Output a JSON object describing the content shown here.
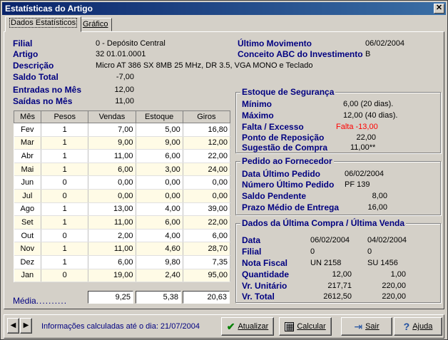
{
  "window": {
    "title": "Estatísticas do Artigo",
    "close_glyph": "✕"
  },
  "tabs": [
    {
      "label": "Dados Estatísticos"
    },
    {
      "label": "Gráfico"
    }
  ],
  "info": {
    "filial_label": "Filial",
    "filial_value": "0 - Depósito Central",
    "artigo_label": "Artigo",
    "artigo_value": "32  01.01.0001",
    "descricao_label": "Descrição",
    "descricao_value": "Micro AT 386 SX 8MB 25 MHz, DR 3.5, VGA MONO e Teclado",
    "saldo_label": "Saldo Total",
    "saldo_value": "-7,00",
    "entradas_label": "Entradas no Mês",
    "entradas_value": "12,00",
    "saidas_label": "Saídas no Mês",
    "saidas_value": "11,00",
    "ultimo_mov_label": "Último Movimento",
    "ultimo_mov_value": "06/02/2004",
    "abc_label": "Conceito ABC do Investimento",
    "abc_value": "B"
  },
  "grid": {
    "headers": [
      "Mês",
      "Pesos",
      "Vendas",
      "Estoque",
      "Giros"
    ],
    "rows": [
      [
        "Fev",
        "1",
        "7,00",
        "5,00",
        "16,80"
      ],
      [
        "Mar",
        "1",
        "9,00",
        "9,00",
        "12,00"
      ],
      [
        "Abr",
        "1",
        "11,00",
        "6,00",
        "22,00"
      ],
      [
        "Mai",
        "1",
        "6,00",
        "3,00",
        "24,00"
      ],
      [
        "Jun",
        "0",
        "0,00",
        "0,00",
        "0,00"
      ],
      [
        "Jul",
        "0",
        "0,00",
        "0,00",
        "0,00"
      ],
      [
        "Ago",
        "1",
        "13,00",
        "4,00",
        "39,00"
      ],
      [
        "Set",
        "1",
        "11,00",
        "6,00",
        "22,00"
      ],
      [
        "Out",
        "0",
        "2,00",
        "4,00",
        "6,00"
      ],
      [
        "Nov",
        "1",
        "11,00",
        "4,60",
        "28,70"
      ],
      [
        "Dez",
        "1",
        "6,00",
        "9,80",
        "7,35"
      ],
      [
        "Jan",
        "0",
        "19,00",
        "2,40",
        "95,00"
      ]
    ],
    "media_label": "Média",
    "media_vendas": "9,25",
    "media_estoque": "5,38",
    "media_giros": "20,63"
  },
  "estoque": {
    "title": "Estoque de Segurança",
    "minimo_label": "Mínimo",
    "minimo_value": "6,00  (20 dias).",
    "maximo_label": "Máximo",
    "maximo_value": "12,00  (40 dias).",
    "falta_label": "Falta / Excesso",
    "falta_value": "Falta -13,00",
    "reposicao_label": "Ponto de Reposição",
    "reposicao_value": "22,00",
    "sugestao_label": "Sugestão de Compra",
    "sugestao_value": "11,00**",
    "falta_color": "#ff0000"
  },
  "pedido": {
    "title": "Pedido ao Fornecedor",
    "data_label": "Data Último Pedido",
    "data_value": "06/02/2004",
    "numero_label": "Número Último Pedido",
    "numero_value": "PF 139",
    "saldo_label": "Saldo Pendente",
    "saldo_value": "8,00",
    "prazo_label": "Prazo Médio de Entrega",
    "prazo_value": "16,00"
  },
  "ultima": {
    "title": "Dados da Última Compra / Última Venda",
    "rows": [
      {
        "label": "Data",
        "compra": "06/02/2004",
        "venda": "04/02/2004"
      },
      {
        "label": "Filial",
        "compra": "0",
        "venda": "0"
      },
      {
        "label": "Nota Fiscal",
        "compra": "UN 2158",
        "venda": "SU 1456"
      },
      {
        "label": "Quantidade",
        "compra": "12,00",
        "venda": "1,00"
      },
      {
        "label": "Vr. Unitário",
        "compra": "217,71",
        "venda": "220,00"
      },
      {
        "label": "Vr. Total",
        "compra": "2612,50",
        "venda": "220,00"
      }
    ]
  },
  "footer": {
    "status": "Informações calculadas até o dia: 21/07/2004",
    "atualizar": "Atualizar",
    "calcular": "Calcular",
    "sair": "Sair",
    "ajuda": "Ajuda",
    "nav_prev_glyph": "◀",
    "nav_next_glyph": "▶"
  },
  "icons": {
    "atualizar": "check-icon",
    "calcular": "calculator-icon",
    "sair": "exit-icon",
    "ajuda": "help-icon"
  },
  "colors": {
    "label": "#000080",
    "title_start": "#0a246a",
    "title_end": "#3a6ea5",
    "status_text": "#000080"
  }
}
